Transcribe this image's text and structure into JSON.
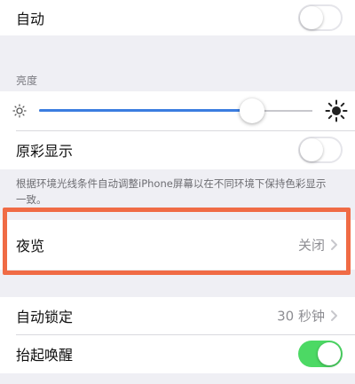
{
  "auto": {
    "label": "自动",
    "enabled": false
  },
  "brightness": {
    "header": "亮度",
    "level": 0.78,
    "track_color": "#3b7de0"
  },
  "true_tone": {
    "label": "原彩显示",
    "enabled": false,
    "note": "根据环境光线条件自动调整iPhone屏幕以在不同环境下保持色彩显示一致。"
  },
  "night_shift": {
    "label": "夜览",
    "value": "关闭"
  },
  "auto_lock": {
    "label": "自动锁定",
    "value": "30 秒钟"
  },
  "raise_to_wake": {
    "label": "抬起唤醒",
    "enabled": true
  },
  "colors": {
    "accent_green": "#4cd964",
    "highlight_border": "#f06b45"
  }
}
